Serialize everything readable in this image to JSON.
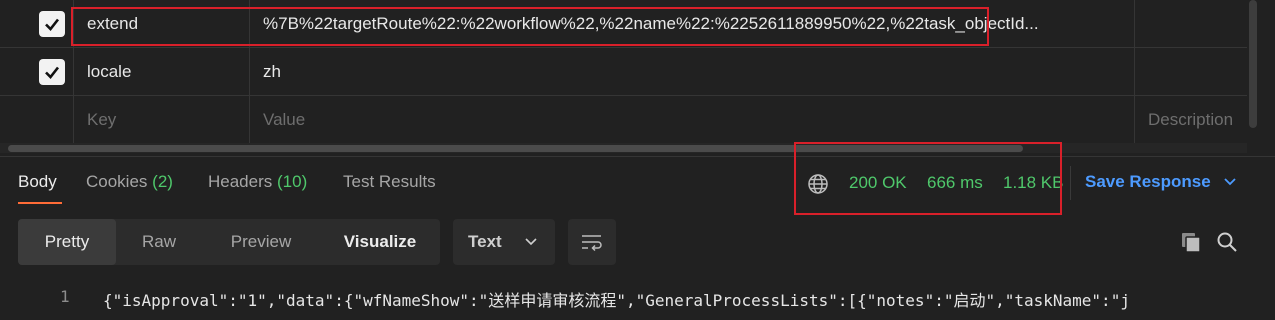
{
  "params": {
    "rows": [
      {
        "key": "extend",
        "value": "%7B%22targetRoute%22:%22workflow%22,%22name%22:%2252611889950%22,%22task_objectId...",
        "checked": true
      },
      {
        "key": "locale",
        "value": "zh",
        "checked": true
      }
    ],
    "placeholder": {
      "key": "Key",
      "value": "Value",
      "description": "Description"
    }
  },
  "response_tabs": [
    {
      "label": "Body",
      "count": ""
    },
    {
      "label": "Cookies",
      "count": "(2)"
    },
    {
      "label": "Headers",
      "count": "(10)"
    },
    {
      "label": "Test Results",
      "count": ""
    }
  ],
  "status": {
    "code": "200 OK",
    "time": "666 ms",
    "size": "1.18 KB",
    "globe_icon": "globe-icon"
  },
  "save_response_label": "Save Response",
  "view_modes": [
    "Pretty",
    "Raw",
    "Preview",
    "Visualize"
  ],
  "format": {
    "selected": "Text"
  },
  "code": {
    "line_number": "1",
    "text": "{\"isApproval\":\"1\",\"data\":{\"wfNameShow\":\"送样申请审核流程\",\"GeneralProcessLists\":[{\"notes\":\"启动\",\"taskName\":\"j"
  },
  "colors": {
    "accent": "#ff6c37",
    "success": "#4fc86b",
    "link": "#4d9bff",
    "highlight_box": "#d9202a"
  }
}
